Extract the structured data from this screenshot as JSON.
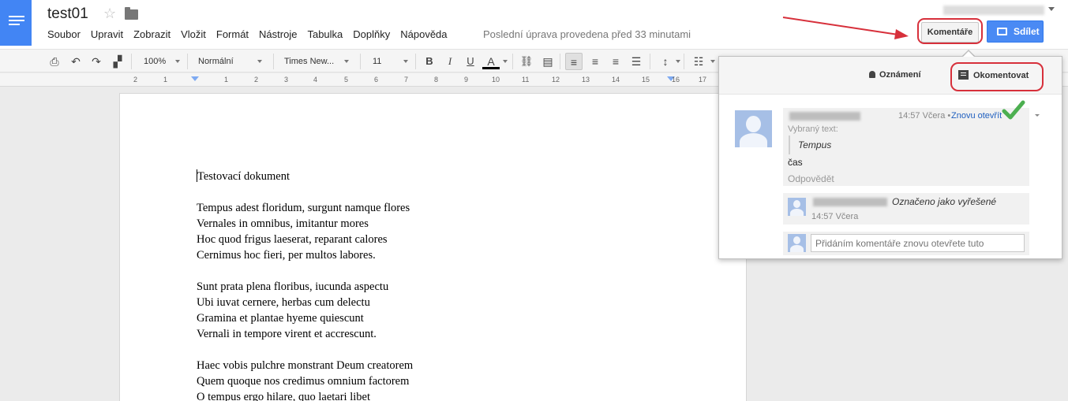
{
  "header": {
    "title": "test01",
    "menu": [
      "Soubor",
      "Upravit",
      "Zobrazit",
      "Vložit",
      "Formát",
      "Nástroje",
      "Tabulka",
      "Doplňky",
      "Nápověda"
    ],
    "last_edit": "Poslední úprava provedena před 33 minutami",
    "comments_label": "Komentáře",
    "share_label": "Sdílet",
    "accent_color": "#4285f4",
    "highlight_color": "#d7303b"
  },
  "toolbar": {
    "zoom": "100%",
    "style": "Normální",
    "font": "Times New...",
    "size": "11",
    "bold": "B",
    "italic": "I",
    "underline": "U",
    "text_color": "A",
    "icons": [
      "print-icon",
      "undo-icon",
      "redo-icon",
      "paint-format-icon",
      "link-icon",
      "comment-icon",
      "align-left-icon",
      "align-center-icon",
      "align-right-icon",
      "justify-icon",
      "line-spacing-icon",
      "numbered-list-icon"
    ]
  },
  "ruler": {
    "numbers": [
      "2",
      "1",
      "1",
      "2",
      "3",
      "4",
      "5",
      "6",
      "7",
      "8",
      "9",
      "10",
      "11",
      "12",
      "13",
      "14",
      "15",
      "16",
      "17"
    ]
  },
  "document": {
    "title_line": "Testovací dokument",
    "stanza1": [
      "Tempus adest floridum, surgunt namque flores",
      "Vernales in omnibus, imitantur mores",
      "Hoc quod frigus laeserat, reparant calores",
      "Cernimus hoc fieri, per multos labores."
    ],
    "stanza2": [
      "Sunt prata plena floribus, iucunda aspectu",
      "Ubi iuvat cernere, herbas cum delectu",
      "Gramina et plantae hyeme quiescunt",
      "Vernali in tempore virent et accrescunt."
    ],
    "stanza3": [
      "Haec vobis pulchre monstrant Deum creatorem",
      "Quem quoque nos credimus omnium factorem",
      "O tempus ergo hilare, quo laetari libet"
    ]
  },
  "comments": {
    "notifications_label": "Oznámení",
    "comment_label": "Okomentovat",
    "thread": {
      "time": "14:57 Včera",
      "separator": "•",
      "reopen_label": "Znovu otevřít",
      "selected_label": "Vybraný text:",
      "quote": "Tempus",
      "text": "čas",
      "reply_label": "Odpovědět"
    },
    "resolved": {
      "text": "Označeno jako vyřešené",
      "time": "14:57 Včera"
    },
    "reply_placeholder": "Přidáním komentáře znovu otevřete tuto"
  }
}
